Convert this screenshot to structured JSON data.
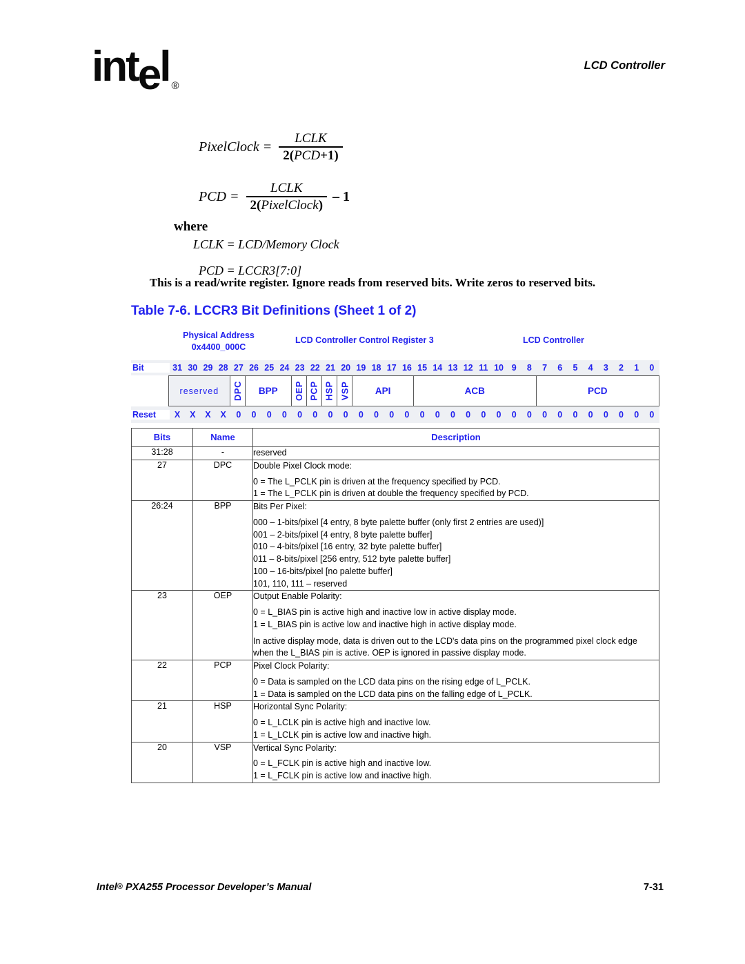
{
  "header": {
    "logo_text": "int",
    "logo_drop": "e",
    "logo_tail": "l",
    "logo_reg": "®",
    "title": "LCD Controller"
  },
  "formulas": {
    "eq1": {
      "lhs": "PixelClock  =",
      "numerator": "LCLK",
      "denominator_prefix": "2(",
      "denominator_body": "PCD",
      "denominator_suffix": "+1)",
      "trailing": ""
    },
    "eq2": {
      "lhs": "PCD  =",
      "numerator": "LCLK",
      "denominator_prefix": "2(",
      "denominator_body": "PixelClock",
      "denominator_suffix": ")",
      "trailing": "– 1"
    },
    "where_label": "where",
    "where_line_1": "LCLK = LCD/Memory Clock",
    "where_line_2": "PCD = LCCR3[7:0]"
  },
  "note": "This is a read/write register. Ignore reads from reserved bits. Write zeros to reserved bits.",
  "table_caption": "Table 7-6. LCCR3 Bit Definitions (Sheet 1 of 2)",
  "register": {
    "physical_address_label": "Physical Address",
    "physical_address_value": "0x4400_000C",
    "register_name": "LCD Controller Control Register 3",
    "unit": "LCD Controller",
    "bit_row_label": "Bit",
    "reset_row_label": "Reset",
    "bits": [
      "31",
      "30",
      "29",
      "28",
      "27",
      "26",
      "25",
      "24",
      "23",
      "22",
      "21",
      "20",
      "19",
      "18",
      "17",
      "16",
      "15",
      "14",
      "13",
      "12",
      "11",
      "10",
      "9",
      "8",
      "7",
      "6",
      "5",
      "4",
      "3",
      "2",
      "1",
      "0"
    ],
    "reset_values": [
      "X",
      "X",
      "X",
      "X",
      "0",
      "0",
      "0",
      "0",
      "0",
      "0",
      "0",
      "0",
      "0",
      "0",
      "0",
      "0",
      "0",
      "0",
      "0",
      "0",
      "0",
      "0",
      "0",
      "0",
      "0",
      "0",
      "0",
      "0",
      "0",
      "0",
      "0",
      "0"
    ],
    "fields": [
      {
        "label": "reserved",
        "span": 4,
        "orientation": "horizontal",
        "shaded": true
      },
      {
        "label": "DPC",
        "span": 1,
        "orientation": "vertical",
        "shaded": false
      },
      {
        "label": "BPP",
        "span": 3,
        "orientation": "horizontal",
        "shaded": false
      },
      {
        "label": "OEP",
        "span": 1,
        "orientation": "vertical",
        "shaded": false
      },
      {
        "label": "PCP",
        "span": 1,
        "orientation": "vertical",
        "shaded": false
      },
      {
        "label": "HSP",
        "span": 1,
        "orientation": "vertical",
        "shaded": false
      },
      {
        "label": "VSP",
        "span": 1,
        "orientation": "vertical",
        "shaded": false
      },
      {
        "label": "API",
        "span": 4,
        "orientation": "horizontal",
        "shaded": false
      },
      {
        "label": "ACB",
        "span": 8,
        "orientation": "horizontal",
        "shaded": false
      },
      {
        "label": "PCD",
        "span": 8,
        "orientation": "horizontal",
        "shaded": false
      }
    ]
  },
  "desc_table": {
    "headers": {
      "bits": "Bits",
      "name": "Name",
      "description": "Description"
    },
    "rows": [
      {
        "bits": "31:28",
        "name": "-",
        "lead": "reserved",
        "options": [],
        "paragraphs": []
      },
      {
        "bits": "27",
        "name": "DPC",
        "lead": "Double Pixel Clock mode:",
        "options": [
          "0 =   The L_PCLK pin is driven at the frequency specified by PCD.",
          "1 =   The L_PCLK pin is driven at double the frequency specified by PCD."
        ],
        "paragraphs": []
      },
      {
        "bits": "26:24",
        "name": "BPP",
        "lead": "Bits Per Pixel:",
        "options": [
          "000 – 1-bits/pixel [4 entry, 8 byte palette buffer (only first 2 entries are used)]",
          "001 – 2-bits/pixel [4 entry, 8 byte palette buffer]",
          "010 – 4-bits/pixel [16 entry, 32 byte palette buffer]",
          "011 – 8-bits/pixel [256 entry, 512 byte palette buffer]",
          "100 – 16-bits/pixel [no palette buffer]",
          "101, 110, 111 – reserved"
        ],
        "paragraphs": []
      },
      {
        "bits": "23",
        "name": "OEP",
        "lead": "Output Enable Polarity:",
        "options": [
          "0 =   L_BIAS pin is active high and inactive low in active display mode.",
          "1 =   L_BIAS pin is active low and inactive high in active display mode."
        ],
        "paragraphs": [
          "In active display mode, data is driven out to the LCD's data pins on the programmed pixel clock edge when the L_BIAS pin is active. OEP is ignored in passive display mode."
        ]
      },
      {
        "bits": "22",
        "name": "PCP",
        "lead": "Pixel Clock Polarity:",
        "options": [
          "0 =   Data is sampled on the LCD data pins on the rising edge of L_PCLK.",
          "1 =   Data is sampled on the LCD data pins on the falling edge of L_PCLK."
        ],
        "paragraphs": []
      },
      {
        "bits": "21",
        "name": "HSP",
        "lead": "Horizontal Sync Polarity:",
        "options": [
          "0 =   L_LCLK pin is active high and inactive low.",
          "1 =   L_LCLK pin is active low and inactive high."
        ],
        "paragraphs": []
      },
      {
        "bits": "20",
        "name": "VSP",
        "lead": "Vertical Sync Polarity:",
        "options": [
          "0 =   L_FCLK pin is active high and inactive low.",
          "1 =   L_FCLK pin is active low and inactive high."
        ],
        "paragraphs": []
      }
    ]
  },
  "footer": {
    "left_prefix": "Intel",
    "left_reg": "®",
    "left_suffix": " PXA255 Processor Developer’s Manual",
    "page": "7-31"
  }
}
